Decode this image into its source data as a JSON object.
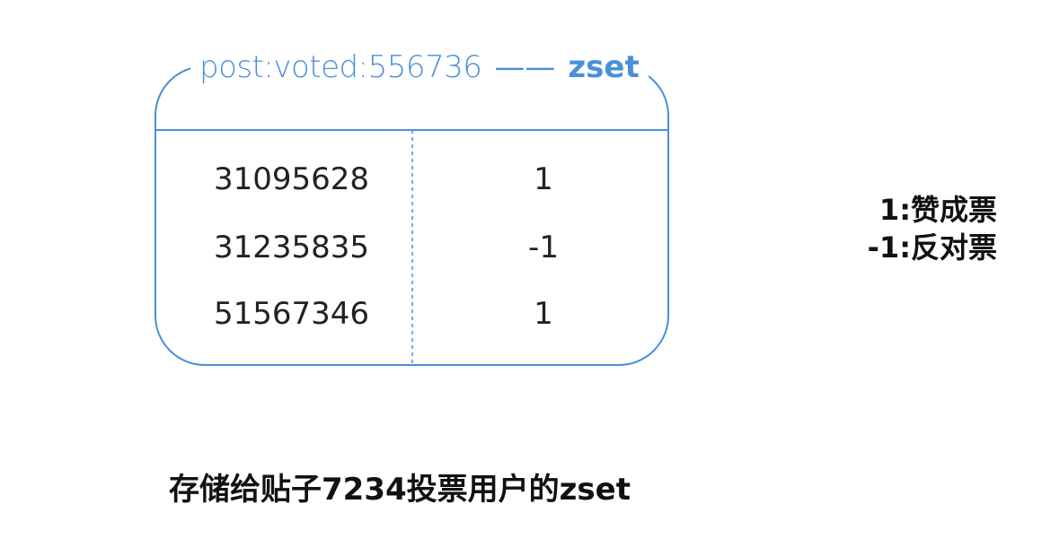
{
  "zset": {
    "key": "post:voted:556736",
    "separator": "——",
    "type": "zset",
    "entries": [
      {
        "member": "31095628",
        "score": "1"
      },
      {
        "member": "31235835",
        "score": "-1"
      },
      {
        "member": "51567346",
        "score": "1"
      }
    ]
  },
  "legend": {
    "upvote": "1:赞成票",
    "downvote": "-1:反对票"
  },
  "caption": "存储给贴子7234投票用户的zset",
  "colors": {
    "accent": "#4a90d9",
    "text": "#222222"
  }
}
